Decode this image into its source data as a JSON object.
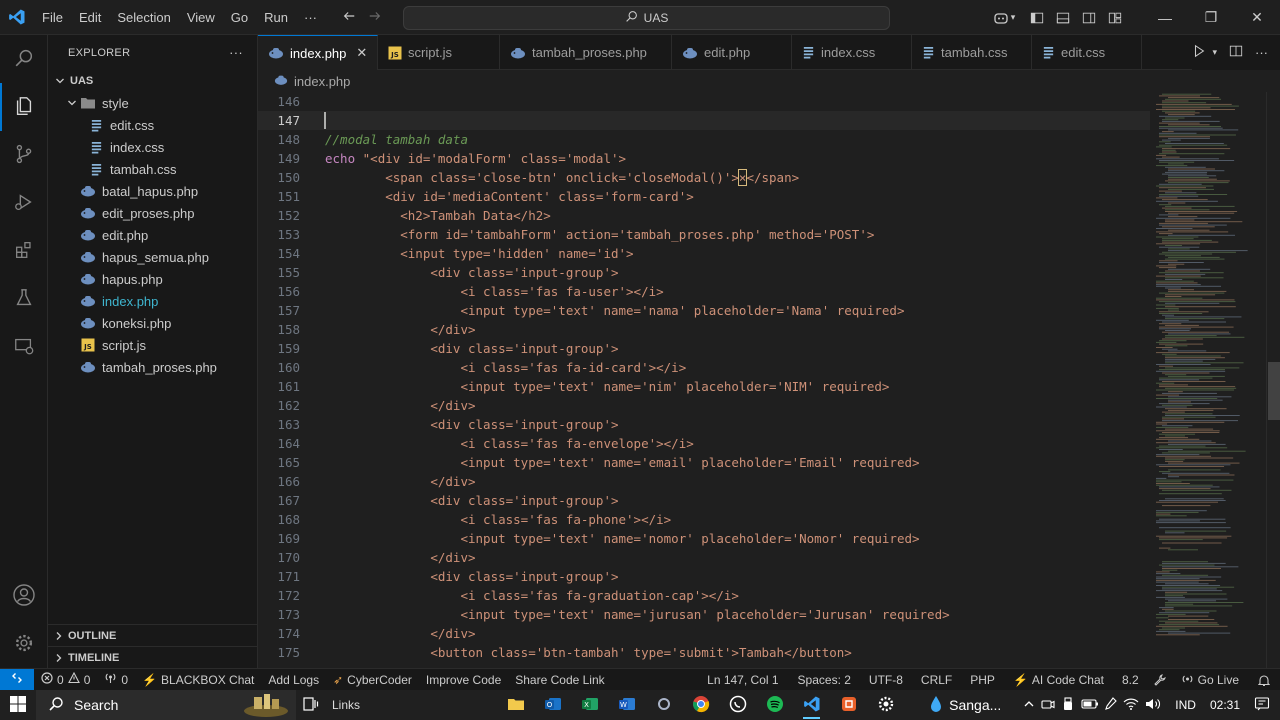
{
  "menu": [
    "File",
    "Edit",
    "Selection",
    "View",
    "Go",
    "Run",
    "···"
  ],
  "command_center": {
    "label": "UAS"
  },
  "window_controls": {
    "minimize": "—",
    "restore": "❐",
    "close": "✕"
  },
  "explorer": {
    "title": "EXPLORER",
    "more": "···",
    "root": "UAS",
    "folder": "style",
    "folder_files": [
      "edit.css",
      "index.css",
      "tambah.css"
    ],
    "files": [
      {
        "name": "batal_hapus.php",
        "type": "php"
      },
      {
        "name": "edit_proses.php",
        "type": "php"
      },
      {
        "name": "edit.php",
        "type": "php"
      },
      {
        "name": "hapus_semua.php",
        "type": "php"
      },
      {
        "name": "hapus.php",
        "type": "php"
      },
      {
        "name": "index.php",
        "type": "php",
        "selected": true
      },
      {
        "name": "koneksi.php",
        "type": "php"
      },
      {
        "name": "script.js",
        "type": "js"
      },
      {
        "name": "tambah_proses.php",
        "type": "php"
      }
    ],
    "outline": "OUTLINE",
    "timeline": "TIMELINE"
  },
  "tabs": [
    {
      "label": "index.php",
      "type": "php",
      "active": true,
      "close": "✕"
    },
    {
      "label": "script.js",
      "type": "js"
    },
    {
      "label": "tambah_proses.php",
      "type": "php"
    },
    {
      "label": "edit.php",
      "type": "php"
    },
    {
      "label": "index.css",
      "type": "css"
    },
    {
      "label": "tambah.css",
      "type": "css"
    },
    {
      "label": "edit.css",
      "type": "css"
    }
  ],
  "breadcrumb": "index.php",
  "editor": {
    "current_line": 147,
    "lines": [
      {
        "n": "146",
        "t": ""
      },
      {
        "n": "147",
        "t": ""
      },
      {
        "n": "148",
        "t": "//modal tambah data",
        "kind": "comment"
      },
      {
        "n": "149",
        "t": "\"<div id='modalForm' class='modal'>",
        "kw": "echo "
      },
      {
        "n": "150",
        "t": "        <span class='close-btn' onclick='closeModal()'>",
        "tail": "</span>",
        "hl": "×"
      },
      {
        "n": "151",
        "t": "        <div id='mediaContent' class='form-card'>"
      },
      {
        "n": "152",
        "t": "          <h2>Tambah Data</h2>"
      },
      {
        "n": "153",
        "t": "          <form id='tambahForm' action='tambah_proses.php' method='POST'>"
      },
      {
        "n": "154",
        "t": "          <input type='hidden' name='id'>"
      },
      {
        "n": "155",
        "t": "              <div class='input-group'>"
      },
      {
        "n": "156",
        "t": "                  <i class='fas fa-user'></i>"
      },
      {
        "n": "157",
        "t": "                  <input type='text' name='nama' placeholder='Nama' required>"
      },
      {
        "n": "158",
        "t": "              </div>"
      },
      {
        "n": "159",
        "t": "              <div class='input-group'>"
      },
      {
        "n": "160",
        "t": "                  <i class='fas fa-id-card'></i>"
      },
      {
        "n": "161",
        "t": "                  <input type='text' name='nim' placeholder='NIM' required>"
      },
      {
        "n": "162",
        "t": "              </div>"
      },
      {
        "n": "163",
        "t": "              <div class='input-group'>"
      },
      {
        "n": "164",
        "t": "                  <i class='fas fa-envelope'></i>"
      },
      {
        "n": "165",
        "t": "                  <input type='text' name='email' placeholder='Email' required>"
      },
      {
        "n": "166",
        "t": "              </div>"
      },
      {
        "n": "167",
        "t": "              <div class='input-group'>"
      },
      {
        "n": "168",
        "t": "                  <i class='fas fa-phone'></i>"
      },
      {
        "n": "169",
        "t": "                  <input type='text' name='nomor' placeholder='Nomor' required>"
      },
      {
        "n": "170",
        "t": "              </div>"
      },
      {
        "n": "171",
        "t": "              <div class='input-group'>"
      },
      {
        "n": "172",
        "t": "                  <i class='fas fa-graduation-cap'></i>"
      },
      {
        "n": "173",
        "t": "                  <input type='text' name='jurusan' placeholder='Jurusan' required>"
      },
      {
        "n": "174",
        "t": "              </div>"
      },
      {
        "n": "175",
        "t": "              <button class='btn-tambah' type='submit'>Tambah</button>"
      }
    ]
  },
  "statusbar": {
    "errors": "0",
    "warnings": "0",
    "ports": "0",
    "blackbox": "BLACKBOX Chat",
    "add_logs": "Add Logs",
    "cybercoder": "CyberCoder",
    "improve": "Improve Code",
    "share": "Share Code Link",
    "position": "Ln 147, Col 1",
    "spaces": "Spaces: 2",
    "encoding": "UTF-8",
    "eol": "CRLF",
    "language": "PHP",
    "ai_chat": "AI Code Chat",
    "version": "8.2",
    "golive": "Go Live"
  },
  "taskbar": {
    "search": "Search",
    "links": "Links",
    "weather": "Sanga...",
    "lang": "IND",
    "time": "02:31"
  },
  "colors": {
    "accent": "#0078d4",
    "selected_file": "#3fb6d0",
    "php_icon": "#6d8fbf",
    "js_icon": "#e8c24b",
    "css_icon": "#8ab4d8"
  }
}
